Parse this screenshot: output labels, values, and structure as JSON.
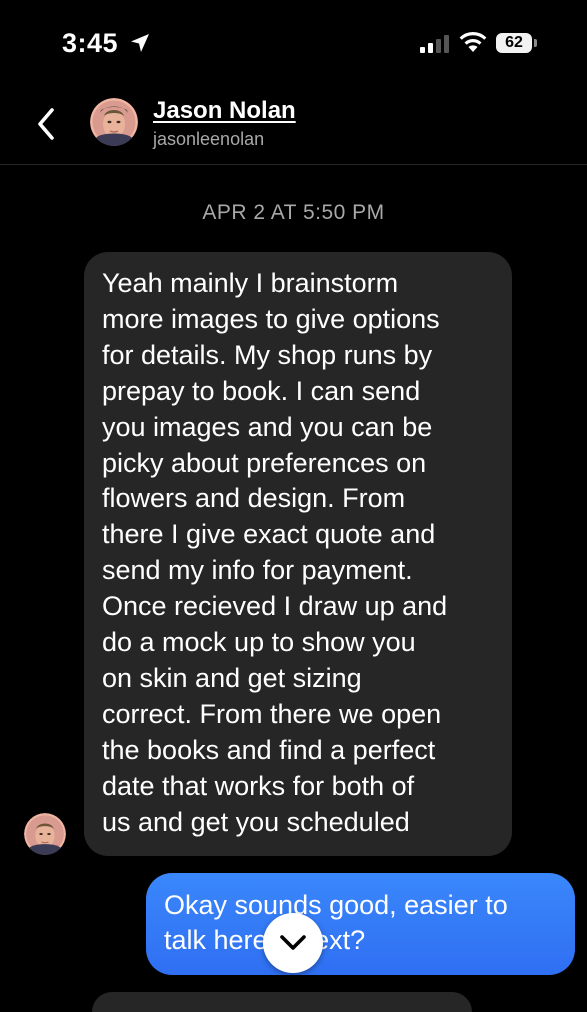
{
  "status_bar": {
    "time": "3:45",
    "battery": "62",
    "icons": [
      "location-arrow-icon",
      "cellular-signal-icon",
      "wifi-icon",
      "battery-icon"
    ]
  },
  "header": {
    "back_icon": "chevron-left-icon",
    "contact_name": "Jason Nolan",
    "contact_handle": "jasonleenolan"
  },
  "chat": {
    "date_separator": "APR 2 AT 5:50 PM",
    "messages": [
      {
        "direction": "incoming",
        "text": "Yeah mainly I brainstorm\nmore images to give options\nfor details. My shop runs by\nprepay to book. I can send\nyou images and you can be\npicky about preferences on\nflowers and design. From\nthere I give exact quote and\nsend my info for payment.\nOnce recieved I draw up and\ndo a mock up to show you\non skin and get sizing\ncorrect. From there we open\nthe books and find a perfect\ndate that works for both of\nus and get you scheduled"
      },
      {
        "direction": "outgoing",
        "text": "Okay sounds good, easier to\ntalk here or text?"
      }
    ],
    "scroll_down_icon": "chevron-down-icon"
  },
  "colors": {
    "background": "#000000",
    "incoming_bubble": "#262626",
    "outgoing_bubble": "#3a87fb",
    "previous_bubble": "#7b3fe4",
    "secondary_text": "#a8a8a8"
  }
}
